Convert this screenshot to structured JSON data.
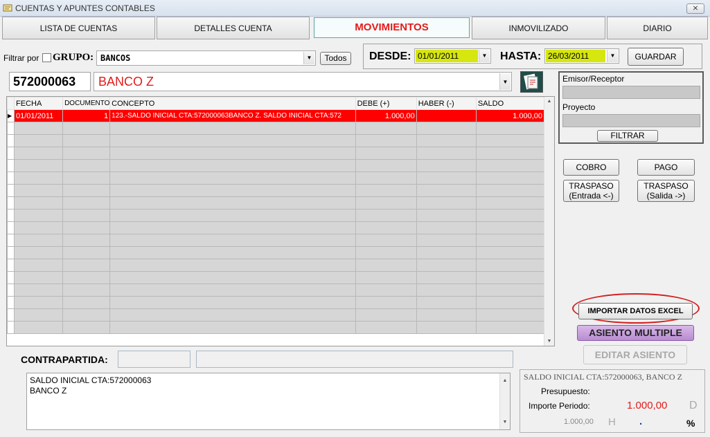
{
  "window": {
    "title": "CUENTAS Y APUNTES CONTABLES",
    "close_label": "⨯"
  },
  "tabs": [
    {
      "label": "LISTA DE CUENTAS"
    },
    {
      "label": "DETALLES CUENTA"
    },
    {
      "label": "MOVIMIENTOS"
    },
    {
      "label": "INMOVILIZADO"
    },
    {
      "label": "DIARIO"
    }
  ],
  "filter": {
    "filtrar_por": "Filtrar por",
    "grupo_label": "GRUPO:",
    "grupo_value": "BANCOS",
    "todos_label": "Todos"
  },
  "dates": {
    "desde_label": "DESDE:",
    "desde_value": "01/01/2011",
    "hasta_label": "HASTA:",
    "hasta_value": "26/03/2011",
    "guardar_label": "GUARDAR"
  },
  "account": {
    "code": "572000063",
    "name": "BANCO Z"
  },
  "grid": {
    "headers": [
      "FECHA",
      "DOCUMENTO",
      "CONCEPTO",
      "DEBE (+)",
      "HABER (-)",
      "SALDO"
    ],
    "rows": [
      {
        "fecha": "01/01/2011",
        "documento": "1",
        "concepto": "123.-SALDO INICIAL CTA:572000063BANCO Z. SALDO INICIAL CTA:572",
        "debe": "1.000,00",
        "haber": "",
        "saldo": "1.000,00"
      }
    ]
  },
  "side_filter": {
    "emisor_label": "Emisor/Receptor",
    "proyecto_label": "Proyecto",
    "filtrar_label": "FILTRAR"
  },
  "actions": {
    "cobro": "COBRO",
    "pago": "PAGO",
    "traspaso_entrada_1": "TRASPASO",
    "traspaso_entrada_2": "(Entrada <-)",
    "traspaso_salida_1": "TRASPASO",
    "traspaso_salida_2": "(Salida ->)",
    "importar": "IMPORTAR DATOS EXCEL",
    "asiento_multiple": "ASIENTO MULTIPLE",
    "editar_asiento": "EDITAR ASIENTO"
  },
  "contrapartida": {
    "label": "CONTRAPARTIDA:"
  },
  "notes": {
    "line1": "SALDO INICIAL CTA:572000063",
    "line2": "BANCO Z"
  },
  "summary": {
    "concept": "SALDO INICIAL CTA:572000063, BANCO Z",
    "presupuesto_label": "Presupuesto:",
    "importe_label": "Importe Periodo:",
    "importe_value": "1.000,00",
    "d_label": "D",
    "small_value": "1.000,00",
    "h_label": "H",
    "dot": ".",
    "pct": "%"
  },
  "colors": {
    "accent_red": "#e41a1a",
    "date_yellow": "#d6e60f",
    "selected_row": "#ff0000",
    "asiento_purple": "#c9a0dc"
  }
}
